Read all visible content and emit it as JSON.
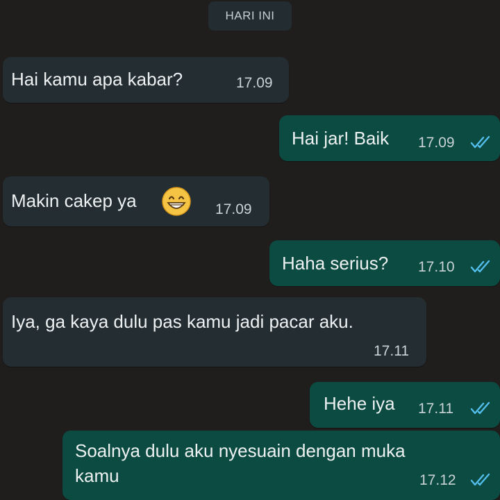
{
  "chat": {
    "day_label": "HARI INI",
    "messages": [
      {
        "text": "Hai kamu apa kabar?",
        "time": "17.09",
        "direction": "incoming"
      },
      {
        "text": "Hai jar! Baik",
        "time": "17.09",
        "direction": "outgoing",
        "status": "read"
      },
      {
        "text": "Makin cakep ya",
        "emoji": "grinning-face-emoji",
        "time": "17.09",
        "direction": "incoming"
      },
      {
        "text": "Haha serius?",
        "time": "17.10",
        "direction": "outgoing",
        "status": "read"
      },
      {
        "text": "Iya, ga kaya dulu pas kamu jadi pacar aku.",
        "time": "17.11",
        "direction": "incoming"
      },
      {
        "text": "Hehe iya",
        "time": "17.11",
        "direction": "outgoing",
        "status": "read"
      },
      {
        "text_line1": "Soalnya dulu aku nyesuain dengan muka",
        "text_line2": "kamu",
        "time": "17.12",
        "direction": "outgoing",
        "status": "read"
      }
    ]
  },
  "colors": {
    "background": "#201e1d",
    "incoming_bubble": "#232d32",
    "outgoing_bubble": "#0b4b41",
    "read_ticks": "#53bdeb"
  }
}
